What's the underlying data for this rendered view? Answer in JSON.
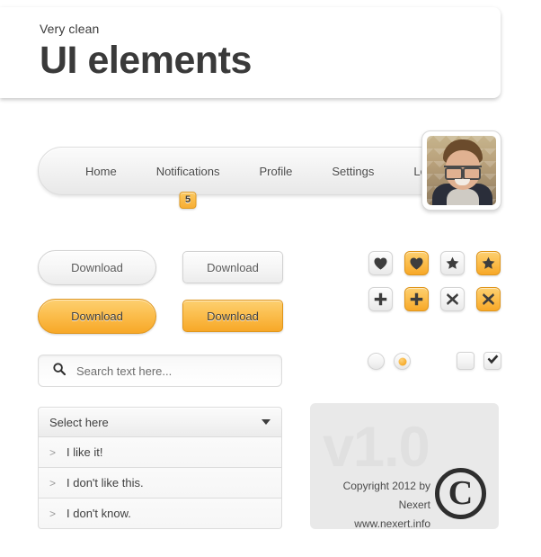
{
  "header": {
    "eyebrow": "Very clean",
    "title": "UI elements",
    "gradient_top": "#fbc95c",
    "gradient_bottom": "#f0a021"
  },
  "nav": {
    "items": [
      {
        "label": "Home"
      },
      {
        "label": "Notifications",
        "badge": "5"
      },
      {
        "label": "Profile"
      },
      {
        "label": "Settings"
      },
      {
        "label": "Logout"
      }
    ]
  },
  "avatar": {
    "name": "user-avatar-photo"
  },
  "buttons": {
    "grey_pill_label": "Download",
    "grey_rect_label": "Download",
    "orange_pill_label": "Download",
    "orange_rect_label": "Download"
  },
  "icon_buttons": [
    {
      "icon": "heart-icon",
      "style": "grey"
    },
    {
      "icon": "heart-icon",
      "style": "orange"
    },
    {
      "icon": "star-icon",
      "style": "grey"
    },
    {
      "icon": "star-icon",
      "style": "orange"
    },
    {
      "icon": "plus-icon",
      "style": "grey"
    },
    {
      "icon": "plus-icon",
      "style": "orange"
    },
    {
      "icon": "close-icon",
      "style": "grey"
    },
    {
      "icon": "close-icon",
      "style": "orange"
    }
  ],
  "search": {
    "value": "",
    "placeholder": "Search text here..."
  },
  "radios": [
    {
      "checked": false
    },
    {
      "checked": true
    }
  ],
  "checkboxes": [
    {
      "checked": false
    },
    {
      "checked": true
    }
  ],
  "dropdown": {
    "label": "Select here",
    "items": [
      {
        "arrow": ">",
        "text": "I like it!"
      },
      {
        "arrow": ">",
        "text": "I don't like this."
      },
      {
        "arrow": ">",
        "text": "I don't know."
      }
    ]
  },
  "footer": {
    "version": "v1.0",
    "copyright": "Copyright 2012 by Nexert",
    "website": "www.nexert.info",
    "symbol": "C"
  },
  "colors": {
    "accent_orange": "#f7a828",
    "page_background": "#ffffff",
    "panel_grey": "#e9e9e9"
  }
}
